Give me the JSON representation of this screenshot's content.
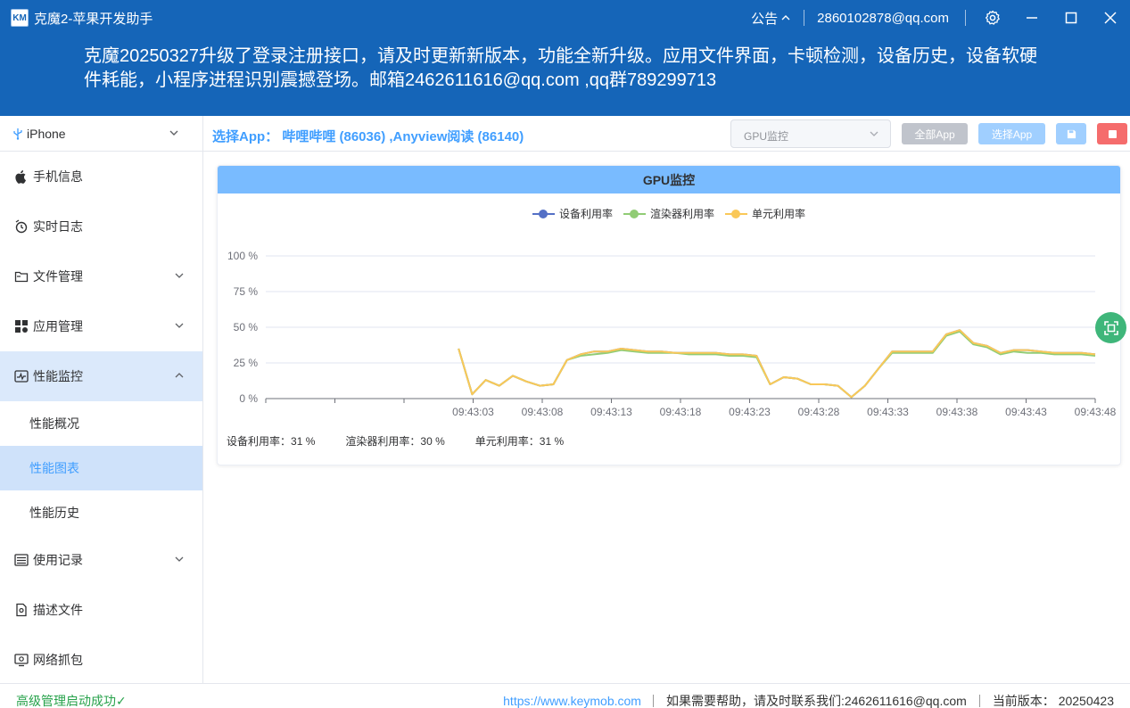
{
  "titlebar": {
    "logo_text": "KM",
    "title": "克魔2-苹果开发助手",
    "notice": "公告",
    "account": "2860102878@qq.com"
  },
  "banner": {
    "text": "克魔20250327升级了登录注册接口，请及时更新新版本，功能全新升级。应用文件界面，卡顿检测，设备历史，设备软硬件耗能，小程序进程识别震撼登场。邮箱2462611616@qq.com ,qq群789299713"
  },
  "sidebar": {
    "device": "iPhone",
    "items": [
      {
        "label": "手机信息",
        "icon": "apple-icon"
      },
      {
        "label": "实时日志",
        "icon": "log-icon"
      },
      {
        "label": "文件管理",
        "icon": "folder-icon",
        "has_arrow": true
      },
      {
        "label": "应用管理",
        "icon": "apps-icon",
        "has_arrow": true
      },
      {
        "label": "性能监控",
        "icon": "monitor-icon",
        "has_arrow": true,
        "open": true
      },
      {
        "label": "使用记录",
        "icon": "record-icon",
        "has_arrow": true
      },
      {
        "label": "描述文件",
        "icon": "profile-icon"
      },
      {
        "label": "网络抓包",
        "icon": "network-icon"
      }
    ],
    "sub_items": [
      {
        "label": "性能概况",
        "active": false
      },
      {
        "label": "性能图表",
        "active": true
      },
      {
        "label": "性能历史",
        "active": false
      }
    ]
  },
  "toolbar": {
    "selected_apps": "选择App： 哔哩哔哩 (86036) ,Anyview阅读 (86140)",
    "monitor_type": "GPU监控",
    "all_app_btn": "全部App",
    "pick_app_btn": "选择App"
  },
  "chart_data": {
    "type": "line",
    "title": "GPU监控",
    "ylim": [
      0,
      100
    ],
    "y_ticks": [
      "0 %",
      "25 %",
      "50 %",
      "75 %",
      "100 %"
    ],
    "x_tick_labels": [
      "09:43:03",
      "09:43:08",
      "09:43:13",
      "09:43:18",
      "09:43:23",
      "09:43:28",
      "09:43:33",
      "09:43:38",
      "09:43:43",
      "09:43:48"
    ],
    "grid": true,
    "legend_position": "top-center",
    "colors": {
      "设备利用率": "#5470c6",
      "渲染器利用率": "#91cc75",
      "单元利用率": "#fac858"
    },
    "series": [
      {
        "name": "设备利用率",
        "color": "#5470c6",
        "values": [
          35,
          3,
          13,
          9,
          16,
          12,
          9,
          10,
          27,
          31,
          33,
          33,
          35,
          34,
          33,
          33,
          32,
          32,
          32,
          32,
          31,
          31,
          30,
          10,
          15,
          14,
          10,
          10,
          9,
          1,
          9,
          21,
          33,
          33,
          33,
          33,
          45,
          48,
          39,
          37,
          32,
          34,
          34,
          33,
          32,
          32,
          32,
          31
        ]
      },
      {
        "name": "渲染器利用率",
        "color": "#91cc75",
        "values": [
          35,
          3,
          13,
          9,
          16,
          12,
          9,
          10,
          27,
          30,
          31,
          32,
          34,
          33,
          32,
          32,
          32,
          31,
          31,
          31,
          30,
          30,
          29,
          10,
          15,
          14,
          10,
          10,
          9,
          1,
          9,
          21,
          32,
          32,
          32,
          32,
          44,
          47,
          38,
          36,
          31,
          33,
          32,
          32,
          31,
          31,
          31,
          30
        ]
      },
      {
        "name": "单元利用率",
        "color": "#fac858",
        "values": [
          35,
          3,
          13,
          9,
          16,
          12,
          9,
          10,
          27,
          31,
          33,
          33,
          35,
          34,
          33,
          33,
          32,
          32,
          32,
          32,
          31,
          31,
          30,
          10,
          15,
          14,
          10,
          10,
          9,
          1,
          9,
          21,
          33,
          33,
          33,
          33,
          45,
          48,
          39,
          37,
          32,
          34,
          34,
          33,
          32,
          32,
          32,
          31
        ]
      }
    ]
  },
  "stats": [
    {
      "label": "设备利用率：",
      "value": "31 %"
    },
    {
      "label": "渲染器利用率：",
      "value": "30 %"
    },
    {
      "label": "单元利用率：",
      "value": "31 %"
    }
  ],
  "footer": {
    "status": "高级管理启动成功",
    "status_check": "✓",
    "link": "https://www.keymob.com",
    "help": "如果需要帮助，请及时联系我们:2462611616@qq.com",
    "version_label": "当前版本：",
    "version": "20250423"
  }
}
